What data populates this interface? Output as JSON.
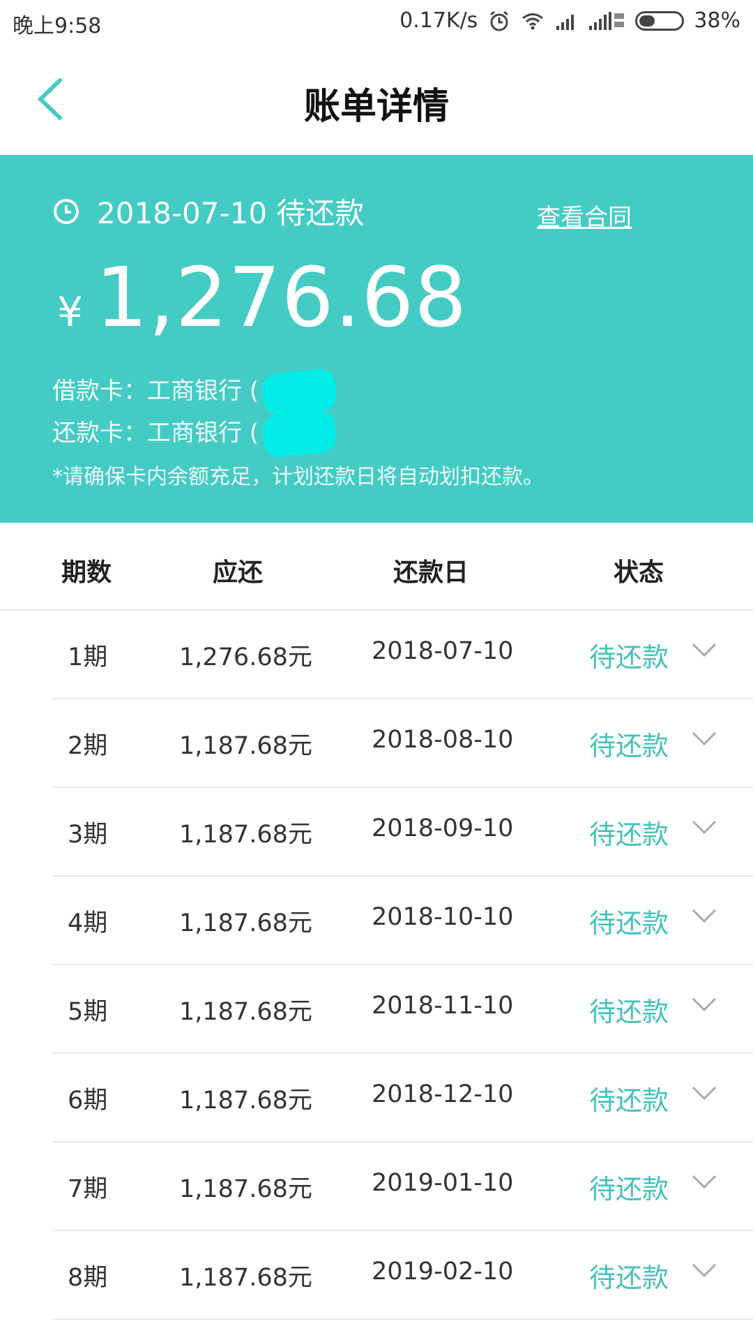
{
  "status_bar": {
    "time": "晚上9:58",
    "net_speed": "0.17K/s",
    "battery_percent": "38%",
    "battery_level": 0.38,
    "icons": [
      "alarm-icon",
      "wifi-icon",
      "signal-icon",
      "signal-3g-icon",
      "battery-icon"
    ]
  },
  "nav": {
    "title": "账单详情",
    "back_icon": "chevron-left-icon"
  },
  "bill": {
    "due_label": "2018-07-10 待还款",
    "contract_link": "查看合同",
    "currency": "¥",
    "amount": "1,276.68",
    "loan_card": "借款卡：工商银行 (",
    "repay_card": "还款卡：工商银行 (",
    "note": "*请确保卡内余额充足，计划还款日将自动划扣还款。"
  },
  "table": {
    "headers": [
      "期数",
      "应还",
      "还款日",
      "状态"
    ],
    "rows": [
      {
        "period": "1期",
        "amount": "1,276.68元",
        "date": "2018-07-10",
        "status": "待还款"
      },
      {
        "period": "2期",
        "amount": "1,187.68元",
        "date": "2018-08-10",
        "status": "待还款"
      },
      {
        "period": "3期",
        "amount": "1,187.68元",
        "date": "2018-09-10",
        "status": "待还款"
      },
      {
        "period": "4期",
        "amount": "1,187.68元",
        "date": "2018-10-10",
        "status": "待还款"
      },
      {
        "period": "5期",
        "amount": "1,187.68元",
        "date": "2018-11-10",
        "status": "待还款"
      },
      {
        "period": "6期",
        "amount": "1,187.68元",
        "date": "2018-12-10",
        "status": "待还款"
      },
      {
        "period": "7期",
        "amount": "1,187.68元",
        "date": "2019-01-10",
        "status": "待还款"
      },
      {
        "period": "8期",
        "amount": "1,187.68元",
        "date": "2019-02-10",
        "status": "待还款"
      }
    ]
  },
  "colors": {
    "accent": "#44cbc4",
    "status_text": "#44c2bb",
    "redaction": "#00f0ec"
  }
}
